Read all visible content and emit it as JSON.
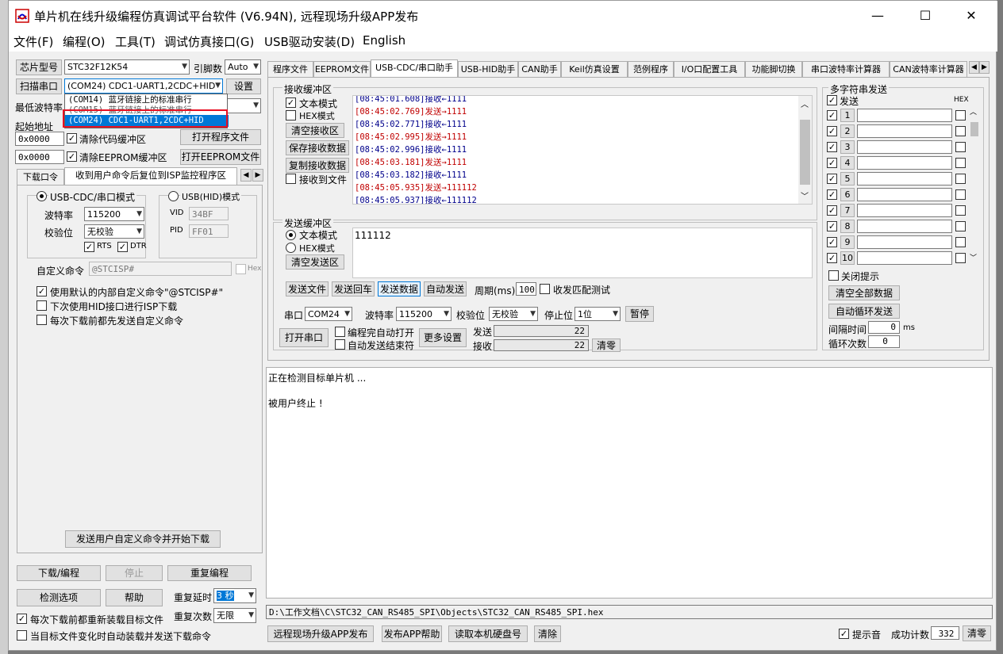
{
  "window": {
    "title": "单片机在线升级编程仿真调试平台软件 (V6.94N), 远程现场升级APP发布",
    "minimize": "—",
    "maximize": "☐",
    "close": "✕"
  },
  "menu": [
    "文件(F)",
    "编程(O)",
    "工具(T)",
    "调试仿真接口(G)",
    "USB驱动安装(D)",
    "English"
  ],
  "left": {
    "chip_label": "芯片型号",
    "chip_value": "STC32F12K54",
    "pin_label": "引脚数",
    "pin_value": "Auto",
    "scan_button": "扫描串口",
    "port_value": "(COM24) CDC1-UART1,2CDC+HID",
    "settings_button": "设置",
    "dropdown": [
      "(COM14) 蓝牙链接上的标准串行",
      "(COM15) 蓝牙链接上的标准串行",
      "(COM24) CDC1-UART1,2CDC+HID"
    ],
    "min_baud_label": "最低波特率",
    "start_addr_label": "起始地址",
    "addr1": "0x0000",
    "addr2": "0x0000",
    "clear_code": "清除代码缓冲区",
    "clear_eeprom": "清除EEPROM缓冲区",
    "open_program": "打开程序文件",
    "open_eeprom": "打开EEPROM文件",
    "tabs": [
      "下载口令",
      "收到用户命令后复位到ISP监控程序区"
    ],
    "usb_cdc_mode": "USB-CDC/串口模式",
    "usb_hid_mode": "USB(HID)模式",
    "baud_label": "波特率",
    "baud_value": "115200",
    "parity_label": "校验位",
    "parity_value": "无校验",
    "vid_label": "VID",
    "vid_value": "34BF",
    "pid_label": "PID",
    "pid_value": "FF01",
    "rts": "RTS",
    "dtr": "DTR",
    "custom_cmd_label": "自定义命令",
    "custom_cmd_value": "@STCISP#",
    "hex_label": "Hex",
    "opt1": "使用默认的内部自定义命令\"@STCISP#\"",
    "opt2": "下次使用HID接口进行ISP下载",
    "opt3": "每次下载前都先发送自定义命令",
    "send_custom_button": "发送用户自定义命令并开始下载",
    "download_button": "下载/编程",
    "stop_button": "停止",
    "reprogram_button": "重复编程",
    "check_button": "检测选项",
    "help_button": "帮助",
    "repeat_delay_label": "重复延时",
    "repeat_delay_value": "3 秒",
    "repeat_count_label": "重复次数",
    "repeat_count_value": "无限",
    "reload_label": "每次下载前都重新装载目标文件",
    "auto_load_label": "当目标文件变化时自动装载并发送下载命令"
  },
  "tabs": [
    "程序文件",
    "EEPROM文件",
    "USB-CDC/串口助手",
    "USB-HID助手",
    "CAN助手",
    "Keil仿真设置",
    "范例程序",
    "I/O口配置工具",
    "功能脚切换",
    "串口波特率计算器",
    "CAN波特率计算器"
  ],
  "serial": {
    "recv_title": "接收缓冲区",
    "text_mode": "文本模式",
    "hex_mode": "HEX模式",
    "clear_recv": "清空接收区",
    "save_recv": "保存接收数据",
    "copy_recv": "复制接收数据",
    "recv_to_file": "接收到文件",
    "log": [
      {
        "t": "[08:45:01.608]",
        "dir": "接收←",
        "v": "1111",
        "kind": "recv"
      },
      {
        "t": "[08:45:02.769]",
        "dir": "发送→",
        "v": "1111",
        "kind": "send"
      },
      {
        "t": "[08:45:02.771]",
        "dir": "接收←",
        "v": "1111",
        "kind": "recv"
      },
      {
        "t": "[08:45:02.995]",
        "dir": "发送→",
        "v": "1111",
        "kind": "send"
      },
      {
        "t": "[08:45:02.996]",
        "dir": "接收←",
        "v": "1111",
        "kind": "recv"
      },
      {
        "t": "[08:45:03.181]",
        "dir": "发送→",
        "v": "1111",
        "kind": "send"
      },
      {
        "t": "[08:45:03.182]",
        "dir": "接收←",
        "v": "1111",
        "kind": "recv"
      },
      {
        "t": "[08:45:05.935]",
        "dir": "发送→",
        "v": "111112",
        "kind": "send"
      },
      {
        "t": "[08:45:05.937]",
        "dir": "接收←",
        "v": "111112",
        "kind": "recv"
      }
    ],
    "send_title": "发送缓冲区",
    "clear_send": "清空发送区",
    "send_text": "111112",
    "send_file": "发送文件",
    "send_enter": "发送回车",
    "send_data": "发送数据",
    "auto_send": "自动发送",
    "period_label": "周期(ms)",
    "period_value": "100",
    "match_test": "收发匹配测试",
    "port_label": "串口",
    "port_value": "COM24",
    "baud_label": "波特率",
    "baud_value": "115200",
    "parity_label": "校验位",
    "parity_value": "无校验",
    "stop_label": "停止位",
    "stop_value": "1位",
    "pause_button": "暂停",
    "open_port": "打开串口",
    "auto_open": "编程完自动打开",
    "auto_end": "自动发送结束符",
    "more_settings": "更多设置",
    "tx_label": "发送",
    "tx_count": "22",
    "rx_label": "接收",
    "rx_count": "22",
    "clear_count": "清零"
  },
  "multi": {
    "title": "多字符串发送",
    "send_label": "发送",
    "hex_label": "HEX",
    "rows": [
      "1",
      "2",
      "3",
      "4",
      "5",
      "6",
      "7",
      "8",
      "9",
      "10"
    ],
    "close_tips": "关闭提示",
    "clear_all": "清空全部数据",
    "auto_cycle": "自动循环发送",
    "interval_label": "间隔时间",
    "interval_value": "0",
    "interval_unit": "ms",
    "cycle_label": "循环次数",
    "cycle_value": "0"
  },
  "output": {
    "line1": "正在检测目标单片机 ...",
    "line2": "被用户终止 !"
  },
  "bottom": {
    "path": "D:\\工作文档\\C\\STC32_CAN_RS485_SPI\\Objects\\STC32_CAN_RS485_SPI.hex",
    "remote_app": "远程现场升级APP发布",
    "publish_help": "发布APP帮助",
    "read_disk": "读取本机硬盘号",
    "clear": "清除",
    "beep_label": "提示音",
    "success_label": "成功计数",
    "success_value": "332",
    "clear_count": "清零"
  },
  "colors": {
    "accent": "#0078d7",
    "highlight": "#e81123",
    "send": "#c00000",
    "recv": "#00008b"
  }
}
